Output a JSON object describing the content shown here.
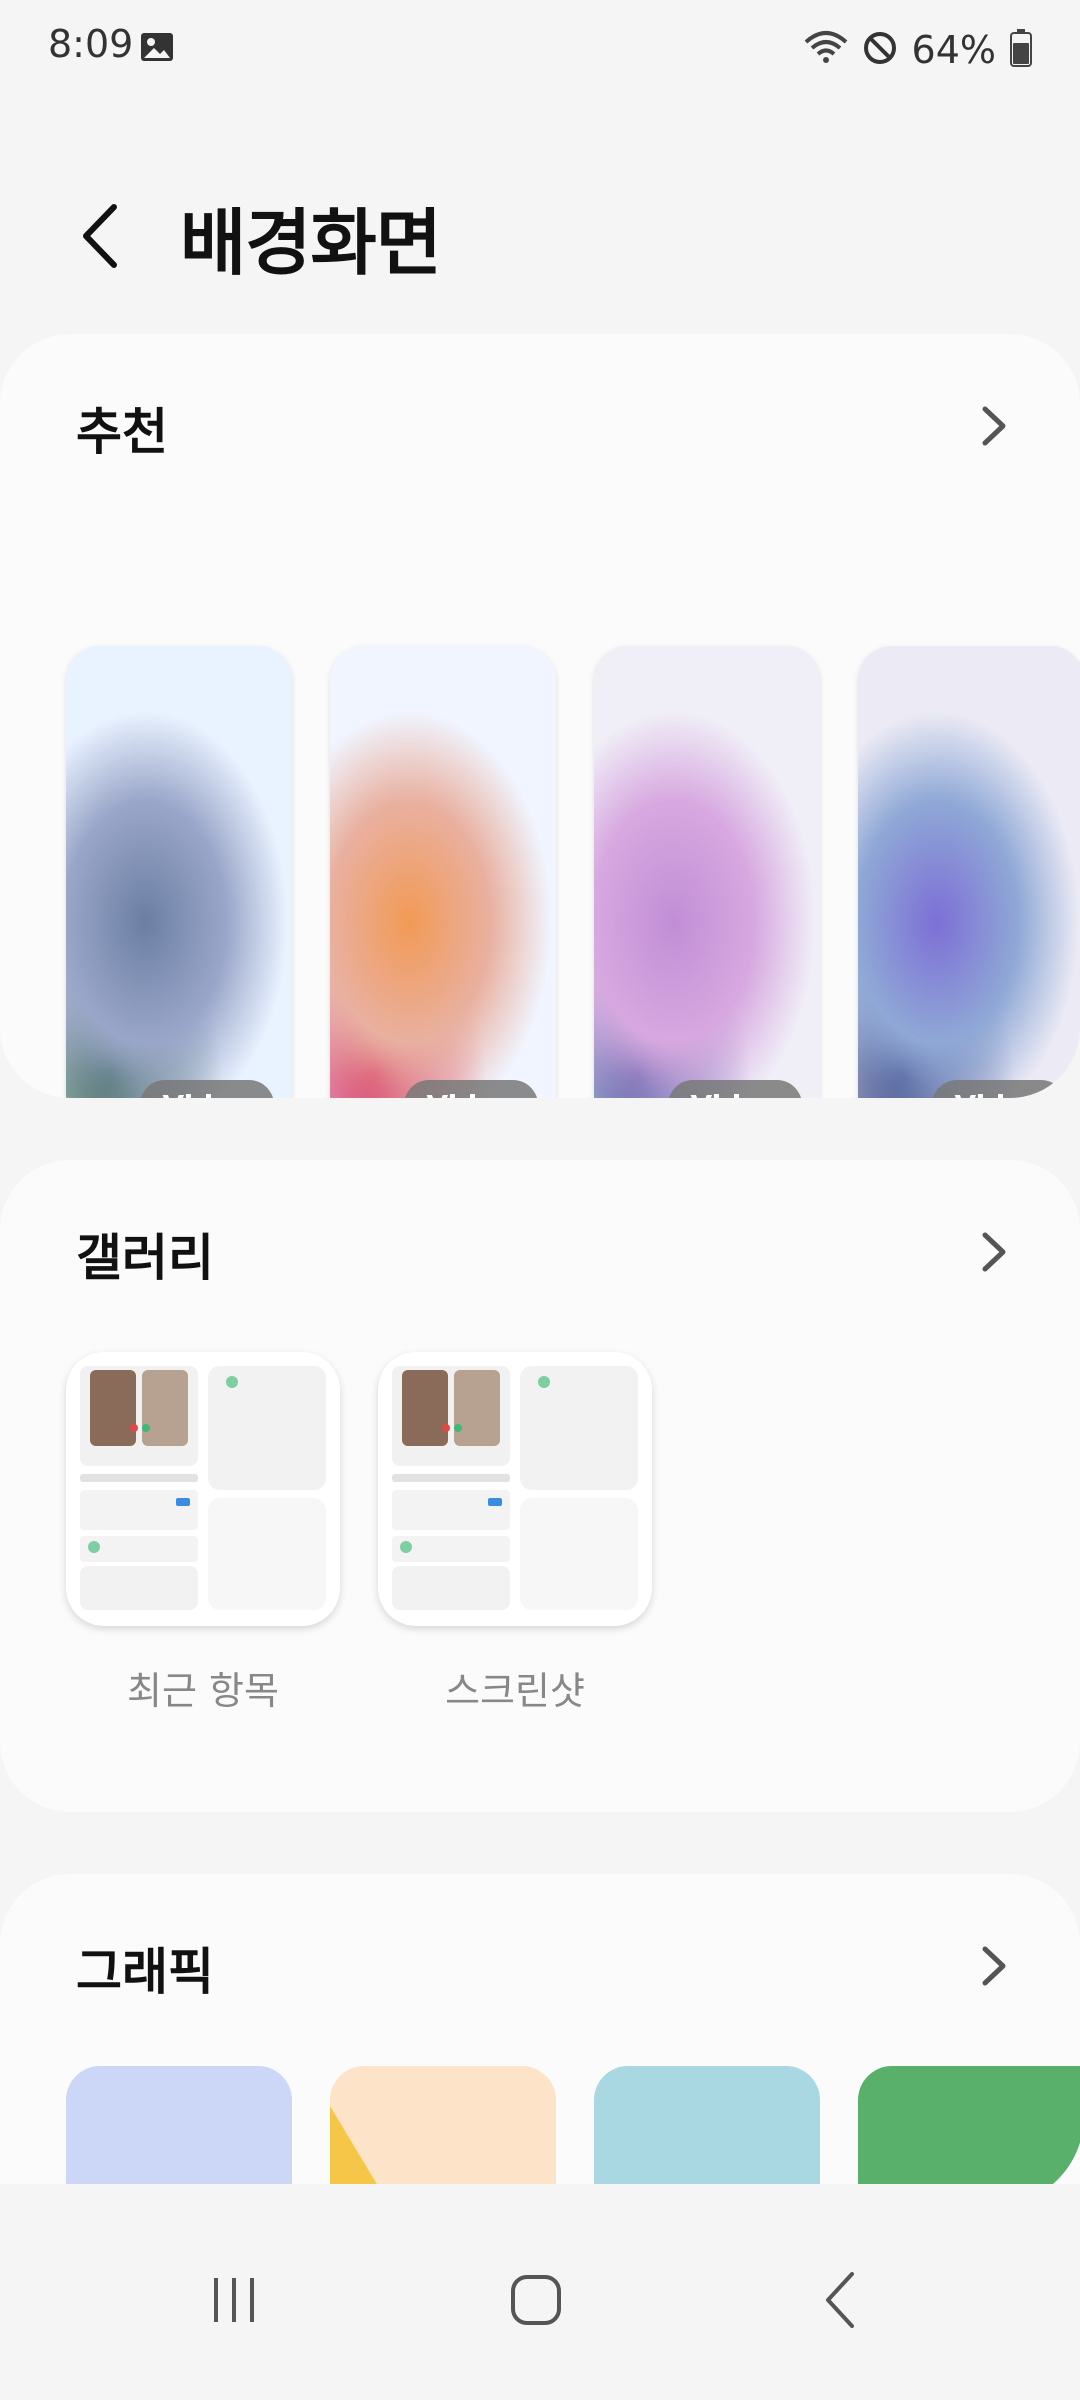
{
  "status_bar": {
    "time": "8:09",
    "battery_percent": "64%",
    "icons": [
      "gallery-notification-icon",
      "wifi-icon",
      "do-not-disturb-icon",
      "battery-icon"
    ]
  },
  "header": {
    "title": "배경화면",
    "back_icon": "back-arrow-icon"
  },
  "recommended": {
    "title": "추천",
    "more_icon": "chevron-right-icon",
    "wallpapers": [
      {
        "badge": "Video",
        "palette": [
          "#e9f2ff",
          "#6b7fa3",
          "#2f5b4a",
          "#9aa6c9"
        ]
      },
      {
        "badge": "Video",
        "palette": [
          "#f0f5ff",
          "#f29a55",
          "#d21c55",
          "#e9b0a0"
        ]
      },
      {
        "badge": "Video",
        "palette": [
          "#f0eef7",
          "#c18ed6",
          "#3f4f9a",
          "#d7a8e0"
        ]
      },
      {
        "badge": "Video",
        "palette": [
          "#ecebf5",
          "#7d6fd6",
          "#2d3a7a",
          "#8fa8d6"
        ]
      }
    ]
  },
  "gallery": {
    "title": "갤러리",
    "more_icon": "chevron-right-icon",
    "albums": [
      {
        "label": "최근 항목"
      },
      {
        "label": "스크린샷"
      }
    ]
  },
  "graphic": {
    "title": "그래픽",
    "more_icon": "chevron-right-icon",
    "tile_colors": [
      "#ccd6f6",
      "#fde3c8",
      "#a9d8e3",
      "#58b06b"
    ],
    "tile_accent": "#f6c648"
  },
  "nav_bar": {
    "icons": [
      "recent-apps-icon",
      "home-icon",
      "back-icon"
    ]
  }
}
